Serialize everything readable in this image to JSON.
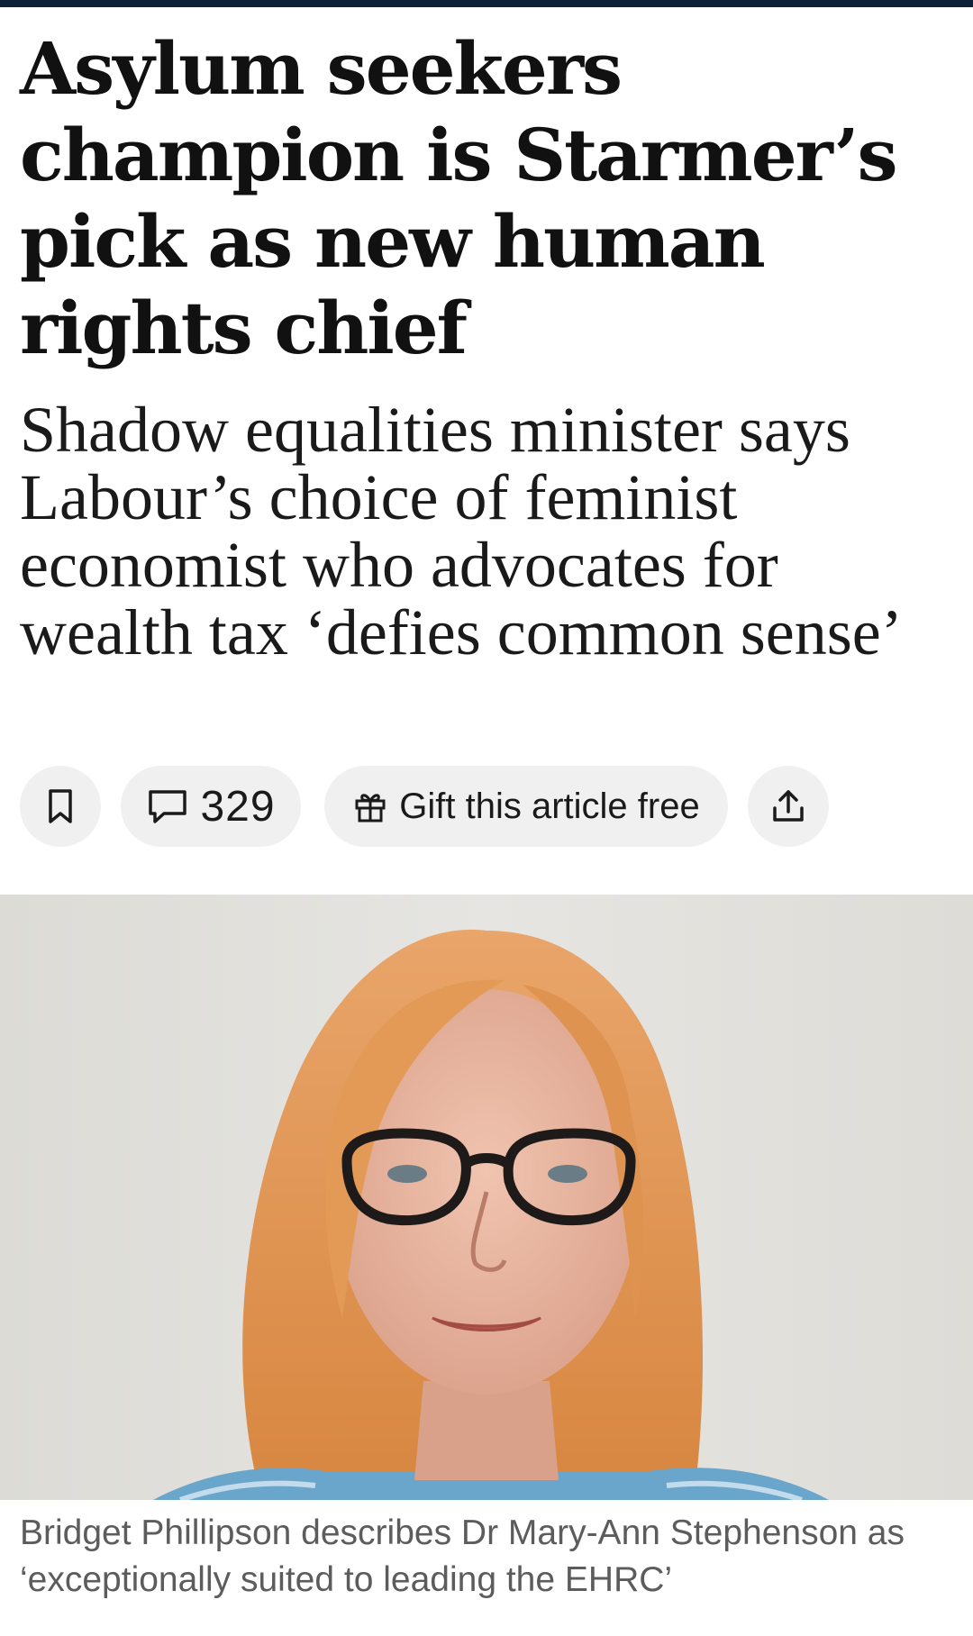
{
  "article": {
    "headline": "Asylum seekers champion is Starmer’s pick as new human rights chief",
    "standfirst": "Shadow equalities minister says Labour’s choice of feminist economist who advocates for wealth tax ‘defies common sense’",
    "caption": "Bridget Phillipson describes Dr Mary-Ann Stephenson as ‘exceptionally suited to leading the EHRC’"
  },
  "actions": {
    "bookmark_icon": "bookmark-icon",
    "comment_icon": "speech-bubble-icon",
    "comment_count": "329",
    "gift_icon": "gift-icon",
    "gift_label": "Gift this article free",
    "share_icon": "share-upload-icon"
  },
  "colors": {
    "top_bar": "#0d2238",
    "pill_background": "#f0f0f0",
    "caption_text": "#5c5c5c",
    "headline_text": "#111111"
  }
}
